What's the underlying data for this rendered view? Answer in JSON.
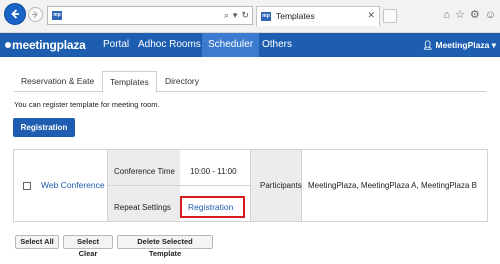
{
  "browser": {
    "tab_title": "Templates",
    "site_badge": "mp",
    "close_glyph": "✕",
    "icons": [
      "back-icon",
      "forward-icon",
      "search-icon",
      "refresh-icon",
      "home-icon",
      "star-icon",
      "gear-icon",
      "smiley-icon"
    ]
  },
  "nav": {
    "logo": "meetingplaza",
    "items": [
      "Portal",
      "Adhoc Rooms",
      "Scheduler",
      "Others"
    ],
    "active": "Scheduler",
    "user": "MeetingPlaza"
  },
  "tabs": [
    {
      "label": "Reservation & Eate",
      "active": false
    },
    {
      "label": "Templates",
      "active": true
    },
    {
      "label": "Directory",
      "active": false
    }
  ],
  "info_text": "You can register template for meeting room.",
  "register_button": "Registration",
  "table": {
    "row": {
      "name": "Web Conference",
      "conference_time_label": "Conference Time",
      "conference_time": "10:00 - 11:00",
      "repeat_label": "Repeat Settings",
      "repeat_link": "Registration",
      "participants_label": "Participants",
      "participants": "MeetingPlaza, MeetingPlaza A, MeetingPlaza B"
    }
  },
  "bottom_buttons": {
    "select_all": "Select All",
    "select_clear": "Select Clear",
    "delete": "Delete Selected Template"
  },
  "colors": {
    "nav_bg": "#1e5eb0",
    "nav_active": "#3d7bd0",
    "link": "#1e5eb0",
    "highlight": "#d51b1b"
  }
}
